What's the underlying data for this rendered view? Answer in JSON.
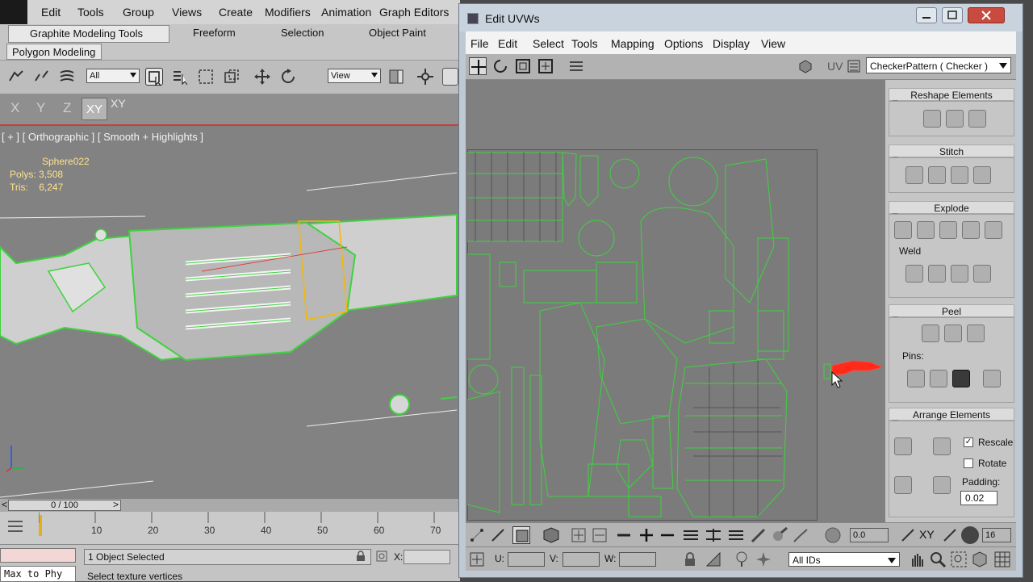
{
  "max": {
    "menus": [
      "Edit",
      "Tools",
      "Group",
      "Views",
      "Create",
      "Modifiers",
      "Animation",
      "Graph Editors"
    ],
    "ribbon_tabs": [
      "Graphite Modeling Tools",
      "Freeform",
      "Selection",
      "Object Paint"
    ],
    "poly_tab": "Polygon Modeling",
    "selection_filter": "All",
    "reference_coord": "View",
    "axes": [
      "X",
      "Y",
      "Z",
      "XY",
      "XY"
    ],
    "viewport": {
      "label": "[ + ] [ Orthographic ] [ Smooth + Highlights ]",
      "object_name": "Sphere022",
      "polys_label": "Polys:",
      "polys_value": "3,508",
      "tris_label": "Tris:",
      "tris_value": "6,247"
    },
    "time_slider": "0 / 100",
    "track_ticks": [
      "10",
      "20",
      "30",
      "40",
      "50",
      "60",
      "70"
    ],
    "maxscript_text": "Max to Phy",
    "selection_status": "1 Object Selected",
    "prompt": "Select texture vertices",
    "coord_x_label": "X:"
  },
  "uvw": {
    "title": "Edit UVWs",
    "menus": [
      "File",
      "Edit",
      "Select",
      "Tools",
      "Mapping",
      "Options",
      "Display",
      "View"
    ],
    "uv_label": "UV",
    "checker": "CheckerPattern  ( Checker )",
    "rollouts": {
      "reshape": "Reshape Elements",
      "stitch": "Stitch",
      "explode": "Explode",
      "weld": "Weld",
      "peel": "Peel",
      "pins": "Pins:",
      "arrange": "Arrange Elements",
      "rescale": "Rescale",
      "rotate": "Rotate",
      "padding_label": "Padding:",
      "padding_value": "0.02",
      "rescale_checked": true,
      "rotate_checked": false
    },
    "bottom": {
      "spin_value": "0.0",
      "xy_label": "XY",
      "grid_value": "16",
      "u_label": "U:",
      "v_label": "V:",
      "w_label": "W:",
      "ids": "All IDs"
    }
  },
  "colors": {
    "uv_wire": "#3fd23f",
    "accent_red": "#c6403a",
    "stats": "#ffe28a"
  }
}
